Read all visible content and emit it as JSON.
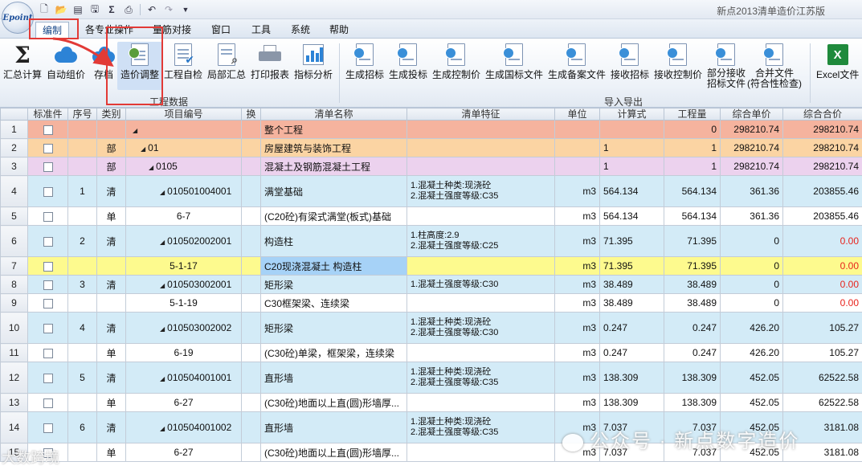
{
  "window": {
    "title": "新点2013清单造价江苏版",
    "logo_text": "Epoint"
  },
  "menu": {
    "tabs": [
      {
        "label": "编制"
      },
      {
        "label": "各专业操作"
      },
      {
        "label": "量筋对接"
      },
      {
        "label": "窗口"
      },
      {
        "label": "工具"
      },
      {
        "label": "系统"
      },
      {
        "label": "帮助"
      }
    ]
  },
  "ribbon": {
    "group1_label": "工程数据",
    "group2_label": "导入导出",
    "buttons": [
      {
        "label": "汇总计算",
        "icon": "sigma-icon"
      },
      {
        "label": "自动组价",
        "icon": "cloud-icon"
      },
      {
        "label": "存档",
        "icon": "cloud-icon"
      },
      {
        "label": "造价调整",
        "icon": "adjust-icon"
      },
      {
        "label": "工程自检",
        "icon": "check-doc-icon"
      },
      {
        "label": "局部汇总",
        "icon": "magnifier-doc-icon"
      },
      {
        "label": "打印报表",
        "icon": "printer-icon"
      },
      {
        "label": "指标分析",
        "icon": "bar-chart-icon"
      },
      {
        "label": "生成招标",
        "icon": "doc-icon"
      },
      {
        "label": "生成投标",
        "icon": "doc-icon"
      },
      {
        "label": "生成控制价",
        "icon": "doc-icon"
      },
      {
        "label": "生成国标文件",
        "icon": "doc-icon"
      },
      {
        "label": "生成备案文件",
        "icon": "doc-icon"
      },
      {
        "label": "接收招标",
        "icon": "doc-icon"
      },
      {
        "label": "接收控制价",
        "icon": "doc-icon"
      },
      {
        "label": "部分接收",
        "label2": "招标文件",
        "icon": "doc-icon"
      },
      {
        "label": "合并文件",
        "label2": "(符合性检查)",
        "icon": "doc-icon"
      },
      {
        "label": "Excel文件",
        "icon": "excel-icon"
      }
    ]
  },
  "grid": {
    "headers": [
      "标准件",
      "序号",
      "类别",
      "项目编号",
      "换",
      "清单名称",
      "清单特征",
      "单位",
      "计算式",
      "工程量",
      "综合单价",
      "综合合价"
    ],
    "rows": [
      {
        "n": "1",
        "seq": "",
        "cat": "",
        "code": "",
        "name": "整个工程",
        "f1": "",
        "f2": "",
        "unit": "",
        "expr": "",
        "qty": "0",
        "price": "298210.74",
        "total": "298210.74",
        "cls": "lvl0"
      },
      {
        "n": "2",
        "seq": "",
        "cat": "部",
        "code": "01",
        "name": "房屋建筑与装饰工程",
        "f1": "",
        "f2": "",
        "unit": "",
        "expr": "1",
        "qty": "1",
        "price": "298210.74",
        "total": "298210.74",
        "cls": "lvl1"
      },
      {
        "n": "3",
        "seq": "",
        "cat": "部",
        "code": "0105",
        "name": "混凝土及钢筋混凝土工程",
        "f1": "",
        "f2": "",
        "unit": "",
        "expr": "1",
        "qty": "1",
        "price": "298210.74",
        "total": "298210.74",
        "cls": "lvl2"
      },
      {
        "n": "4",
        "seq": "1",
        "cat": "清",
        "code": "010501004001",
        "name": "满堂基础",
        "f1": "1.混凝土种类:现浇砼",
        "f2": "2.混凝土强度等级:C35",
        "unit": "m3",
        "expr": "564.134",
        "qty": "564.134",
        "price": "361.36",
        "total": "203855.46",
        "cls": "qing"
      },
      {
        "n": "5",
        "seq": "",
        "cat": "单",
        "code": "6-7",
        "name": "(C20砼)有梁式满堂(板式)基础",
        "f1": "",
        "f2": "",
        "unit": "m3",
        "expr": "564.134",
        "qty": "564.134",
        "price": "361.36",
        "total": "203855.46",
        "cls": "dan"
      },
      {
        "n": "6",
        "seq": "2",
        "cat": "清",
        "code": "010502002001",
        "name": "构造柱",
        "f1": "1.柱高度:2.9",
        "f2": "2.混凝土强度等级:C25",
        "unit": "m3",
        "expr": "71.395",
        "qty": "71.395",
        "price": "0",
        "total": "0.00",
        "cls": "qing"
      },
      {
        "n": "7",
        "seq": "",
        "cat": "",
        "code": "5-1-17",
        "name": "C20现浇混凝土 构造柱",
        "f1": "",
        "f2": "",
        "unit": "m3",
        "expr": "71.395",
        "qty": "71.395",
        "price": "0",
        "total": "0.00",
        "cls": "sel"
      },
      {
        "n": "8",
        "seq": "3",
        "cat": "清",
        "code": "010503002001",
        "name": "矩形梁",
        "f1": "1.混凝土强度等级:C30",
        "f2": "",
        "unit": "m3",
        "expr": "38.489",
        "qty": "38.489",
        "price": "0",
        "total": "0.00",
        "cls": "qing"
      },
      {
        "n": "9",
        "seq": "",
        "cat": "",
        "code": "5-1-19",
        "name": "C30框架梁、连续梁",
        "f1": "",
        "f2": "",
        "unit": "m3",
        "expr": "38.489",
        "qty": "38.489",
        "price": "0",
        "total": "0.00",
        "cls": "dan"
      },
      {
        "n": "10",
        "seq": "4",
        "cat": "清",
        "code": "010503002002",
        "name": "矩形梁",
        "f1": "1.混凝土种类:现浇砼",
        "f2": "2.混凝土强度等级:C30",
        "unit": "m3",
        "expr": "0.247",
        "qty": "0.247",
        "price": "426.20",
        "total": "105.27",
        "cls": "qing"
      },
      {
        "n": "11",
        "seq": "",
        "cat": "单",
        "code": "6-19",
        "name": "(C30砼)单梁，框架梁，连续梁",
        "f1": "",
        "f2": "",
        "unit": "m3",
        "expr": "0.247",
        "qty": "0.247",
        "price": "426.20",
        "total": "105.27",
        "cls": "dan"
      },
      {
        "n": "12",
        "seq": "5",
        "cat": "清",
        "code": "010504001001",
        "name": "直形墙",
        "f1": "1.混凝土种类:现浇砼",
        "f2": "2.混凝土强度等级:C35",
        "unit": "m3",
        "expr": "138.309",
        "qty": "138.309",
        "price": "452.05",
        "total": "62522.58",
        "cls": "qing"
      },
      {
        "n": "13",
        "seq": "",
        "cat": "单",
        "code": "6-27",
        "name": "(C30砼)地面以上直(圆)形墙厚...",
        "f1": "",
        "f2": "",
        "unit": "m3",
        "expr": "138.309",
        "qty": "138.309",
        "price": "452.05",
        "total": "62522.58",
        "cls": "dan"
      },
      {
        "n": "14",
        "seq": "6",
        "cat": "清",
        "code": "010504001002",
        "name": "直形墙",
        "f1": "1.混凝土种类:现浇砼",
        "f2": "2.混凝土强度等级:C35",
        "unit": "m3",
        "expr": "7.037",
        "qty": "7.037",
        "price": "452.05",
        "total": "3181.08",
        "cls": "qing"
      },
      {
        "n": "15",
        "seq": "",
        "cat": "单",
        "code": "6-27",
        "name": "(C30砼)地面以上直(圆)形墙厚...",
        "f1": "",
        "f2": "",
        "unit": "m3",
        "expr": "7.037",
        "qty": "7.037",
        "price": "452.05",
        "total": "3181.08",
        "cls": "dan"
      }
    ]
  },
  "watermark": {
    "left": "大数跨境",
    "right": "公众号 · 新点数字造价"
  },
  "colors": {
    "highlight_red": "#e23a36",
    "negative_zero_red": "#e8231c",
    "level0": "#f5b39e",
    "level1": "#fbd4a3",
    "level2": "#ecd2ee",
    "list_row": "#d3ebf7",
    "selected_row": "#fdfa8e",
    "current_cell": "#a6d2f7"
  }
}
